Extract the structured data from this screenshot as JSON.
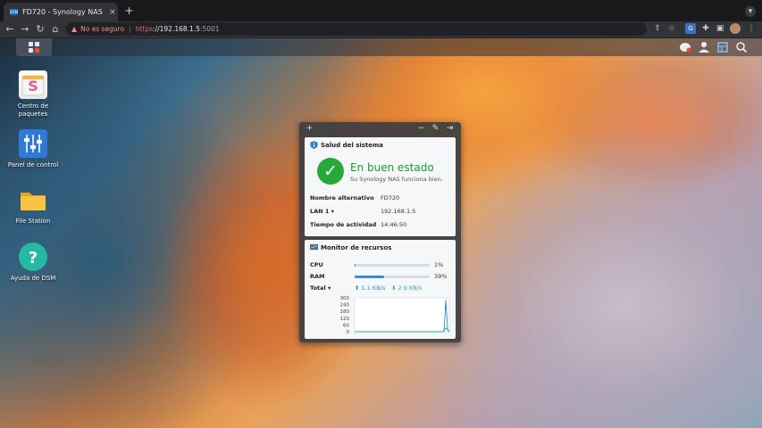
{
  "browser": {
    "tab_title": "FD720 - Synology NAS",
    "favicon_text": "DSM",
    "tab_close": "×",
    "new_tab": "+",
    "insecure_label": "No es seguro",
    "url_scheme": "https",
    "url_host": "://192.168.1.5",
    "url_port": ":5001",
    "separator": "|"
  },
  "desktop": {
    "icons": [
      {
        "label": "Centro de paquetes",
        "icon": "package-center-icon"
      },
      {
        "label": "Panel de control",
        "icon": "control-panel-icon"
      },
      {
        "label": "File Station",
        "icon": "folder-icon"
      },
      {
        "label": "Ayuda de DSM",
        "icon": "help-icon"
      }
    ],
    "tray_icons": [
      "chat-icon",
      "user-icon",
      "widgets-icon",
      "search-icon"
    ]
  },
  "widget": {
    "health": {
      "title": "Salud del sistema",
      "status": "En buen estado",
      "status_sub": "Su Synology NAS funciona bien.",
      "rows": [
        {
          "key": "Nombre alternativo",
          "value": "FD720"
        },
        {
          "key": "LAN 1 ▾",
          "value": "192.168.1.5"
        },
        {
          "key": "Tiempo de actividad",
          "value": "14:46:50"
        }
      ]
    },
    "monitor": {
      "title": "Monitor de recursos",
      "cpu_label": "CPU",
      "cpu_pct": "1%",
      "cpu_value": 1,
      "ram_label": "RAM",
      "ram_pct": "39%",
      "ram_value": 39,
      "total_label": "Total ▾",
      "upload": "1.1 KB/s",
      "download": "2.9 KB/s",
      "upload_color": "#2a87d0",
      "download_color": "#1fb5a6"
    }
  },
  "chart_data": {
    "type": "line",
    "yticks": [
      "300",
      "240",
      "180",
      "120",
      "60",
      "0"
    ],
    "ylim": [
      0,
      300
    ],
    "series": [
      {
        "values": [
          0,
          0,
          0,
          0,
          0,
          0,
          0,
          0,
          0,
          0,
          0,
          0,
          0,
          0,
          0,
          0,
          0,
          0,
          0,
          0,
          0,
          0,
          0,
          0,
          0,
          0,
          0,
          0,
          0,
          0,
          0,
          0,
          0,
          0,
          0,
          0,
          0,
          0,
          0,
          0,
          0,
          0,
          0,
          0,
          0,
          0,
          0,
          0,
          0,
          0,
          0,
          5,
          280,
          20,
          0
        ]
      },
      {
        "values": [
          0,
          0,
          0,
          0,
          0,
          0,
          0,
          0,
          0,
          0,
          0,
          0,
          0,
          0,
          0,
          0,
          0,
          0,
          0,
          0,
          0,
          0,
          0,
          0,
          0,
          0,
          0,
          0,
          0,
          0,
          0,
          0,
          0,
          0,
          0,
          0,
          0,
          0,
          0,
          0,
          0,
          0,
          0,
          0,
          0,
          0,
          0,
          0,
          0,
          0,
          0,
          10,
          35,
          15,
          0
        ]
      }
    ]
  }
}
